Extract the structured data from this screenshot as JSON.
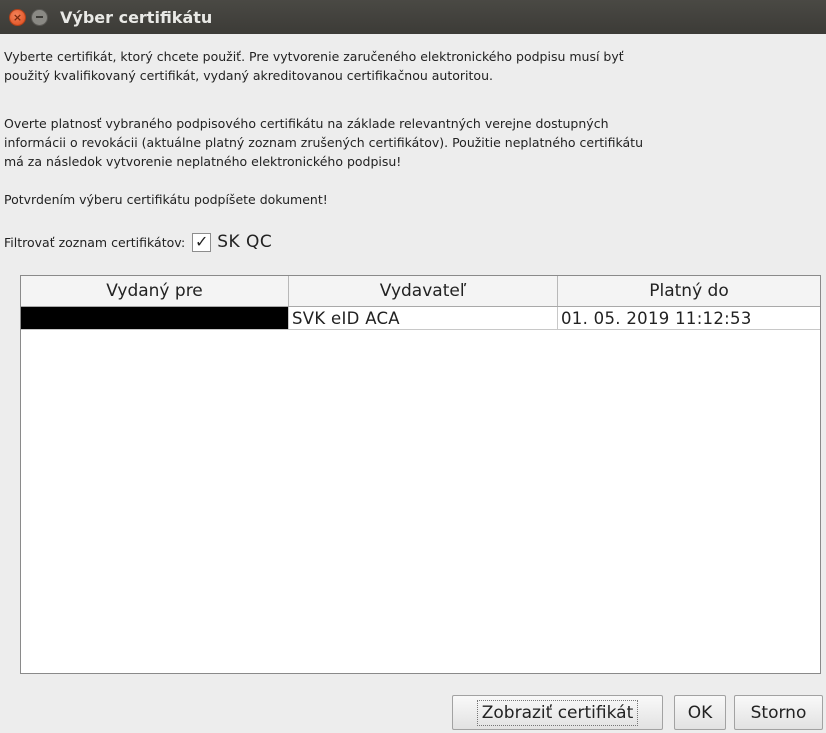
{
  "window": {
    "title": "Výber certifikátu",
    "close_icon": "close-icon",
    "minimize_icon": "minimize-icon"
  },
  "intro": {
    "paragraph1": "Vyberte certifikát, ktorý chcete použiť. Pre vytvorenie zaručeného elektronického podpisu musí byť\npoužitý kvalifikovaný certifikát, vydaný akreditovanou certifikačnou autoritou.",
    "paragraph2": "Overte platnosť vybraného podpisového certifikátu na základe relevantných verejne dostupných\ninformácii o revokácii (aktuálne platný zoznam zrušených certifikátov). Použitie neplatného certifikátu\nmá za následok vytvorenie neplatného elektronického podpisu!",
    "paragraph3": "Potvrdením výberu certifikátu podpíšete dokument!"
  },
  "filter": {
    "label": "Filtrovať zoznam certifikátov:",
    "checked": true,
    "check_mark": "✓",
    "value": "SK QC"
  },
  "table": {
    "columns": [
      "Vydaný pre",
      "Vydavateľ",
      "Platný do"
    ],
    "rows": [
      {
        "issued_to": "",
        "issuer": "SVK eID ACA",
        "valid_until": "01. 05. 2019 11:12:53"
      }
    ]
  },
  "buttons": {
    "show_certificate": "Zobraziť certifikát",
    "ok": "OK",
    "cancel": "Storno"
  }
}
